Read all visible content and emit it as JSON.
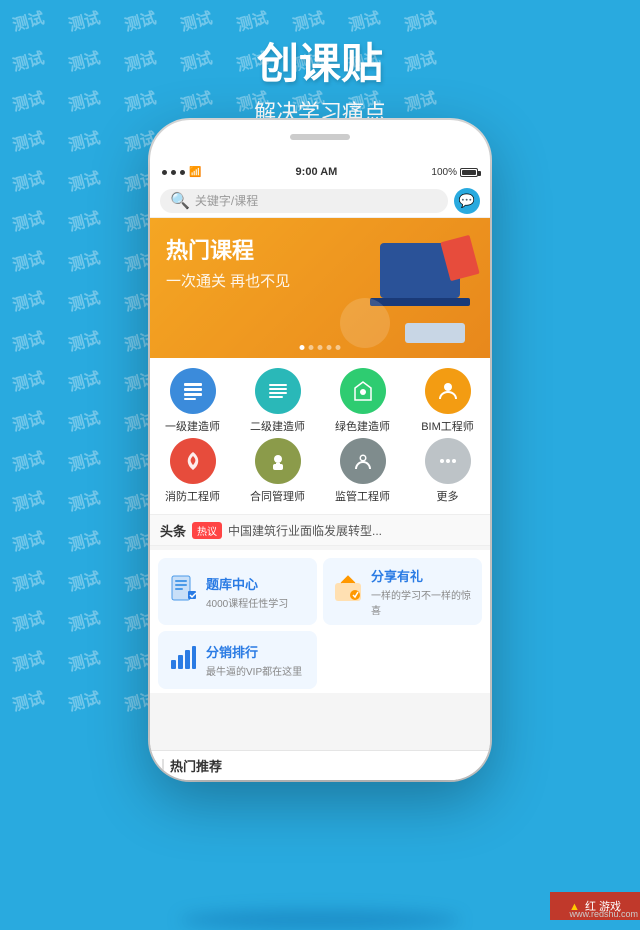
{
  "background": {
    "color": "#29aadf",
    "watermark_text": "测试"
  },
  "app": {
    "title": "创课贴",
    "subtitle": "解决学习痛点"
  },
  "status_bar": {
    "time": "9:00 AM",
    "battery": "100%",
    "signal": "●●●"
  },
  "search": {
    "placeholder": "关键字/课程",
    "icon": "search"
  },
  "banner": {
    "title": "热门课程",
    "subtitle": "一次通关 再也不见",
    "dots": [
      true,
      false,
      false,
      false,
      false
    ]
  },
  "categories": [
    {
      "id": "cat1",
      "label": "一级建造师",
      "color": "cat-blue"
    },
    {
      "id": "cat2",
      "label": "二级建造师",
      "color": "cat-teal"
    },
    {
      "id": "cat3",
      "label": "绿色建造师",
      "color": "cat-green"
    },
    {
      "id": "cat4",
      "label": "BIM工程师",
      "color": "cat-orange"
    },
    {
      "id": "cat5",
      "label": "消防工程师",
      "color": "cat-red"
    },
    {
      "id": "cat6",
      "label": "合同管理师",
      "color": "cat-olive"
    },
    {
      "id": "cat7",
      "label": "监管工程师",
      "color": "cat-gray-blue"
    },
    {
      "id": "cat8",
      "label": "更多",
      "color": "cat-more"
    }
  ],
  "news": {
    "head_label": "头条",
    "hot_badge": "热议",
    "text": "中国建筑行业面临发展转型..."
  },
  "features": [
    {
      "id": "tiku",
      "title": "题库中心",
      "desc": "4000课程任性学习",
      "icon": "📋",
      "bg": "#f0f7ff"
    },
    {
      "id": "share",
      "title": "分享有礼",
      "desc": "一样的学习不一样的惊喜",
      "icon": "🎁",
      "bg": "#f0f7ff"
    },
    {
      "id": "fenpai",
      "title": "分销排行",
      "desc": "最牛逼的VIP都在这里",
      "icon": "📊",
      "bg": "#f0f7ff"
    }
  ],
  "bottom_nav": {
    "label": "热门推荐"
  },
  "watermark": {
    "url": "www.redshu.com",
    "logo_text": "红 游戏"
  }
}
